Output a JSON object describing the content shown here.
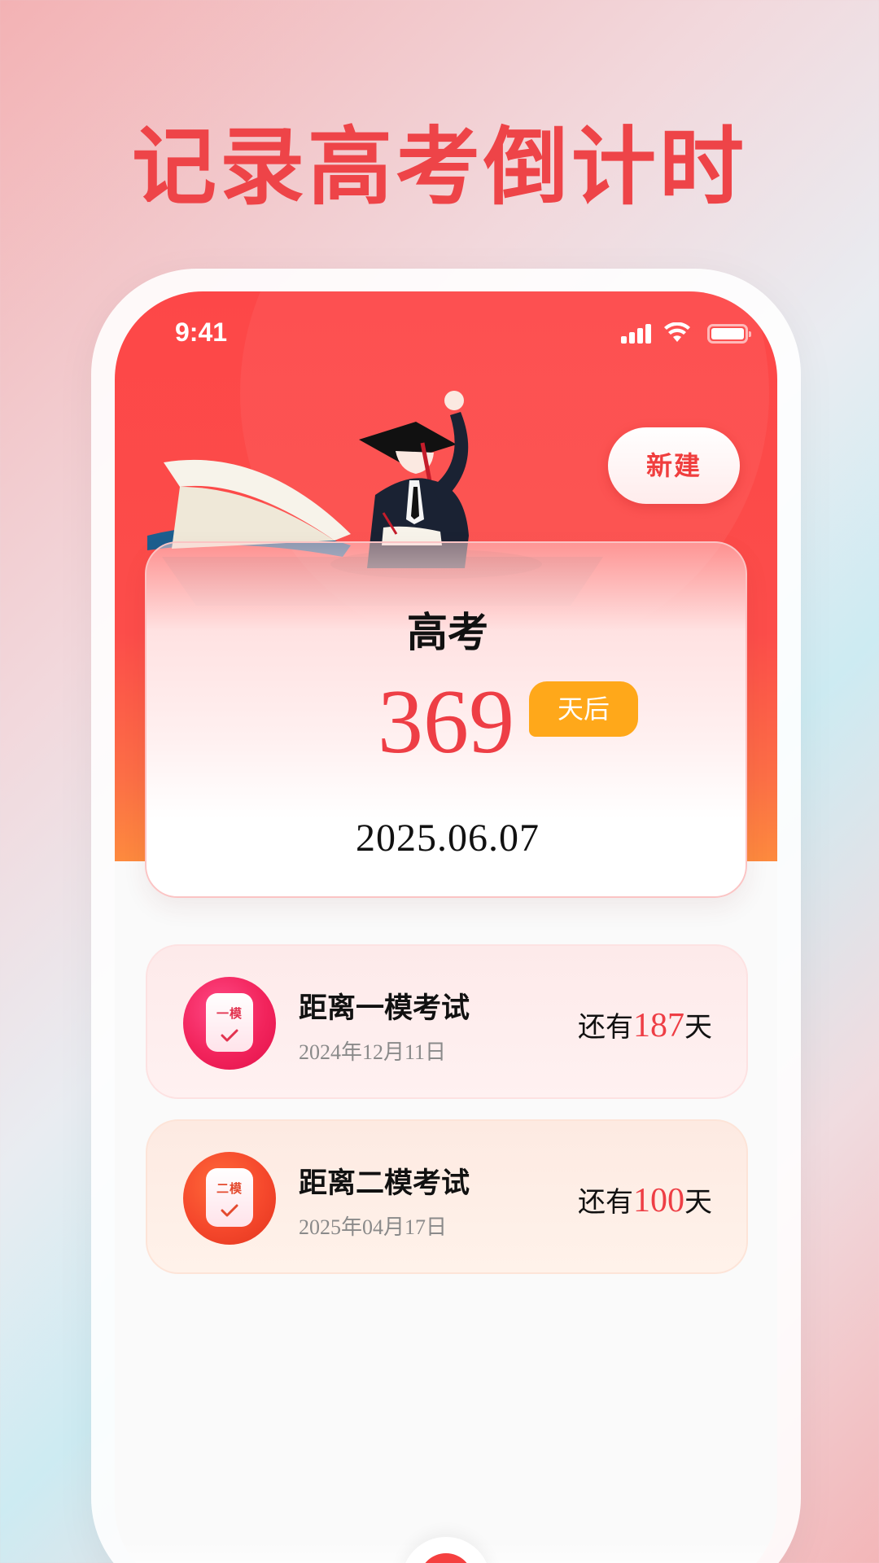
{
  "headline": "记录高考倒计时",
  "status_bar": {
    "time": "9:41",
    "icons": [
      "signal-icon",
      "wifi-icon",
      "battery-icon"
    ]
  },
  "header": {
    "new_button_label": "新建"
  },
  "main_countdown": {
    "title": "高考",
    "days": "369",
    "suffix": "天后",
    "date": "2025.06.07"
  },
  "exams": [
    {
      "icon_tag": "一模",
      "name": "距离一模考试",
      "date": "2024年12月11日",
      "prefix": "还有",
      "days": "187",
      "unit": "天"
    },
    {
      "icon_tag": "二模",
      "name": "距离二模考试",
      "date": "2025年04月17日",
      "prefix": "还有",
      "days": "100",
      "unit": "天"
    }
  ],
  "colors": {
    "accent_red": "#ee3e45",
    "hero_top": "#fd4748",
    "hero_bottom": "#fd8a3e",
    "badge_orange": "#ffa81a"
  }
}
